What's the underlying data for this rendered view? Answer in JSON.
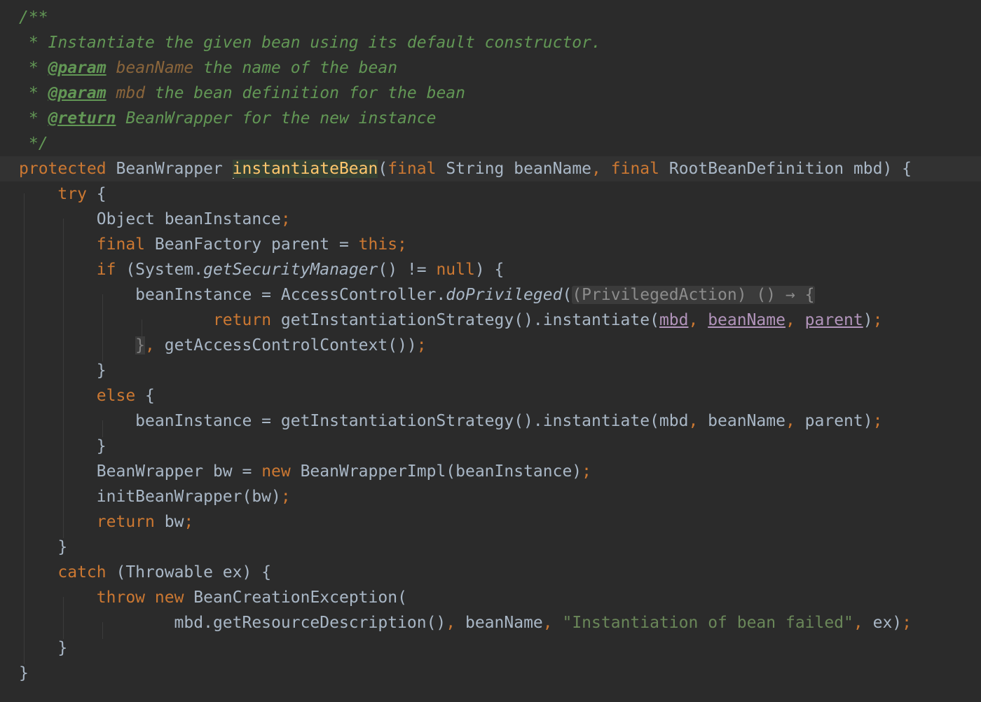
{
  "editor": {
    "language": "java",
    "theme": "darcula",
    "colors": {
      "background": "#2b2b2b",
      "current_line": "#323232",
      "keyword": "#cc7832",
      "comment": "#629755",
      "function_decl": "#ffc66d",
      "string": "#6a8759",
      "text": "#a9b7c6",
      "captured_var": "#b294bb"
    },
    "lines": [
      {
        "tokens": [
          {
            "t": "/**",
            "c": "cm"
          }
        ]
      },
      {
        "tokens": [
          {
            "t": " * Instantiate the given bean using its default constructor.",
            "c": "cm"
          }
        ]
      },
      {
        "tokens": [
          {
            "t": " * ",
            "c": "cm"
          },
          {
            "t": "@param",
            "c": "tag"
          },
          {
            "t": " ",
            "c": "cm"
          },
          {
            "t": "beanName",
            "c": "pname"
          },
          {
            "t": " the name of the bean",
            "c": "cm"
          }
        ]
      },
      {
        "tokens": [
          {
            "t": " * ",
            "c": "cm"
          },
          {
            "t": "@param",
            "c": "tag"
          },
          {
            "t": " ",
            "c": "cm"
          },
          {
            "t": "mbd",
            "c": "pname"
          },
          {
            "t": " the bean definition for the bean",
            "c": "cm"
          }
        ]
      },
      {
        "tokens": [
          {
            "t": " * ",
            "c": "cm"
          },
          {
            "t": "@return",
            "c": "tag"
          },
          {
            "t": " BeanWrapper for the new instance",
            "c": "cm"
          }
        ]
      },
      {
        "tokens": [
          {
            "t": " */",
            "c": "cm"
          }
        ]
      },
      {
        "current": true,
        "tokens": [
          {
            "t": "protected",
            "c": "kw"
          },
          {
            "t": " BeanWrapper ",
            "c": ""
          },
          {
            "t": "",
            "c": "caret"
          },
          {
            "t": "instantiateBean",
            "c": "fn hl"
          },
          {
            "t": "(",
            "c": ""
          },
          {
            "t": "final",
            "c": "kw"
          },
          {
            "t": " String beanName",
            "c": ""
          },
          {
            "t": ",",
            "c": "kw"
          },
          {
            "t": " ",
            "c": ""
          },
          {
            "t": "final",
            "c": "kw"
          },
          {
            "t": " RootBeanDefinition mbd) {",
            "c": ""
          }
        ]
      },
      {
        "tokens": [
          {
            "t": "    ",
            "c": ""
          },
          {
            "t": "try",
            "c": "kw"
          },
          {
            "t": " {",
            "c": ""
          }
        ]
      },
      {
        "tokens": [
          {
            "t": "        Object beanInstance",
            "c": ""
          },
          {
            "t": ";",
            "c": "kw"
          }
        ]
      },
      {
        "tokens": [
          {
            "t": "        ",
            "c": ""
          },
          {
            "t": "final",
            "c": "kw"
          },
          {
            "t": " BeanFactory parent = ",
            "c": ""
          },
          {
            "t": "this;",
            "c": "kw"
          }
        ]
      },
      {
        "tokens": [
          {
            "t": "        ",
            "c": ""
          },
          {
            "t": "if",
            "c": "kw"
          },
          {
            "t": " (System.",
            "c": ""
          },
          {
            "t": "getSecurityManager",
            "c": "it"
          },
          {
            "t": "() != ",
            "c": ""
          },
          {
            "t": "null",
            "c": "kw"
          },
          {
            "t": ") {",
            "c": ""
          }
        ]
      },
      {
        "tokens": [
          {
            "t": "            beanInstance = AccessController.",
            "c": ""
          },
          {
            "t": "doPrivileged",
            "c": "it"
          },
          {
            "t": "(",
            "c": ""
          },
          {
            "t": "(PrivilegedAction) () → {",
            "c": "hint"
          }
        ]
      },
      {
        "tokens": [
          {
            "t": "                    ",
            "c": ""
          },
          {
            "t": "return",
            "c": "kw"
          },
          {
            "t": " getInstantiationStrategy().instantiate(",
            "c": ""
          },
          {
            "t": "mbd",
            "c": "cap"
          },
          {
            "t": ", ",
            "c": "kw"
          },
          {
            "t": "beanName",
            "c": "cap"
          },
          {
            "t": ", ",
            "c": "kw"
          },
          {
            "t": "parent",
            "c": "cap"
          },
          {
            "t": ")",
            "c": ""
          },
          {
            "t": ";",
            "c": "kw"
          }
        ]
      },
      {
        "tokens": [
          {
            "t": "            ",
            "c": ""
          },
          {
            "t": "}",
            "c": "dim"
          },
          {
            "t": ",",
            "c": "kw"
          },
          {
            "t": " getAccessControlContext())",
            "c": ""
          },
          {
            "t": ";",
            "c": "kw"
          }
        ]
      },
      {
        "tokens": [
          {
            "t": "        }",
            "c": ""
          }
        ]
      },
      {
        "tokens": [
          {
            "t": "        ",
            "c": ""
          },
          {
            "t": "else",
            "c": "kw"
          },
          {
            "t": " {",
            "c": ""
          }
        ]
      },
      {
        "tokens": [
          {
            "t": "            beanInstance = getInstantiationStrategy().instantiate(mbd",
            "c": ""
          },
          {
            "t": ",",
            "c": "kw"
          },
          {
            "t": " beanName",
            "c": ""
          },
          {
            "t": ",",
            "c": "kw"
          },
          {
            "t": " parent)",
            "c": ""
          },
          {
            "t": ";",
            "c": "kw"
          }
        ]
      },
      {
        "tokens": [
          {
            "t": "        }",
            "c": ""
          }
        ]
      },
      {
        "tokens": [
          {
            "t": "        BeanWrapper bw = ",
            "c": ""
          },
          {
            "t": "new",
            "c": "kw"
          },
          {
            "t": " BeanWrapperImpl(beanInstance)",
            "c": ""
          },
          {
            "t": ";",
            "c": "kw"
          }
        ]
      },
      {
        "tokens": [
          {
            "t": "        initBeanWrapper(bw)",
            "c": ""
          },
          {
            "t": ";",
            "c": "kw"
          }
        ]
      },
      {
        "tokens": [
          {
            "t": "        ",
            "c": ""
          },
          {
            "t": "return",
            "c": "kw"
          },
          {
            "t": " bw",
            "c": ""
          },
          {
            "t": ";",
            "c": "kw"
          }
        ]
      },
      {
        "tokens": [
          {
            "t": "    }",
            "c": ""
          }
        ]
      },
      {
        "tokens": [
          {
            "t": "    ",
            "c": ""
          },
          {
            "t": "catch",
            "c": "kw"
          },
          {
            "t": " (Throwable ex) {",
            "c": ""
          }
        ]
      },
      {
        "tokens": [
          {
            "t": "        ",
            "c": ""
          },
          {
            "t": "throw",
            "c": "kw"
          },
          {
            "t": " ",
            "c": ""
          },
          {
            "t": "new",
            "c": "kw"
          },
          {
            "t": " BeanCreationException(",
            "c": ""
          }
        ]
      },
      {
        "tokens": [
          {
            "t": "                mbd.getResourceDescription()",
            "c": ""
          },
          {
            "t": ",",
            "c": "kw"
          },
          {
            "t": " beanName",
            "c": ""
          },
          {
            "t": ",",
            "c": "kw"
          },
          {
            "t": " ",
            "c": ""
          },
          {
            "t": "\"Instantiation of bean failed\"",
            "c": "str"
          },
          {
            "t": ",",
            "c": "kw"
          },
          {
            "t": " ex)",
            "c": ""
          },
          {
            "t": ";",
            "c": "kw"
          }
        ]
      },
      {
        "tokens": [
          {
            "t": "    }",
            "c": ""
          }
        ]
      },
      {
        "tokens": [
          {
            "t": "}",
            "c": ""
          }
        ]
      }
    ]
  }
}
